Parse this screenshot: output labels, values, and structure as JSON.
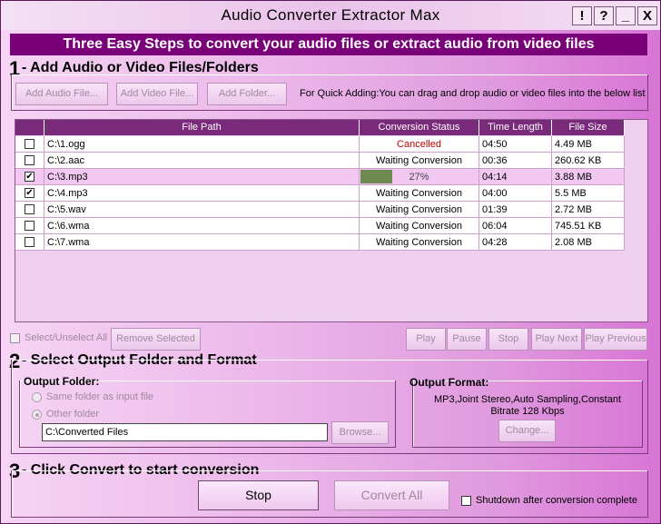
{
  "window": {
    "title": "Audio Converter Extractor Max",
    "btn_excl": "!",
    "btn_help": "?",
    "btn_min": "_",
    "btn_close": "X"
  },
  "banner": "Three Easy Steps to convert your audio files or extract audio from video files",
  "step1": {
    "num": "1",
    "title": "- Add Audio or Video Files/Folders",
    "add_audio": "Add Audio File...",
    "add_video": "Add Video File...",
    "add_folder": "Add Folder...",
    "hint": "For Quick Adding:You can drag and drop audio or video files into the below list"
  },
  "table": {
    "headers": [
      "File Path",
      "Conversion Status",
      "Time Length",
      "File Size"
    ],
    "rows": [
      {
        "checked": false,
        "path": "C:\\1.ogg",
        "status": "Cancelled",
        "time": "04:50",
        "size": "4.49 MB",
        "progress": null
      },
      {
        "checked": false,
        "path": "C:\\2.aac",
        "status": "Waiting Conversion",
        "time": "00:36",
        "size": "260.62 KB",
        "progress": null
      },
      {
        "checked": true,
        "path": "C:\\3.mp3",
        "status": "27%",
        "time": "04:14",
        "size": "3.88 MB",
        "progress": 0.27
      },
      {
        "checked": true,
        "path": "C:\\4.mp3",
        "status": "Waiting Conversion",
        "time": "04:00",
        "size": "5.5 MB",
        "progress": null
      },
      {
        "checked": false,
        "path": "C:\\5.wav",
        "status": "Waiting Conversion",
        "time": "01:39",
        "size": "2.72 MB",
        "progress": null
      },
      {
        "checked": false,
        "path": "C:\\6.wma",
        "status": "Waiting Conversion",
        "time": "06:04",
        "size": "745.51 KB",
        "progress": null
      },
      {
        "checked": false,
        "path": "C:\\7.wma",
        "status": "Waiting Conversion",
        "time": "04:28",
        "size": "2.08 MB",
        "progress": null
      }
    ],
    "colors": {
      "cancelled": "#c00000",
      "progress_fill": "#6e8a50"
    }
  },
  "list_controls": {
    "select_all": "Select/Unselect All",
    "remove": "Remove Selected",
    "play": "Play",
    "pause": "Pause",
    "stop": "Stop",
    "play_next": "Play Next",
    "play_previous": "Play Previous"
  },
  "step2": {
    "num": "2",
    "title": "- Select Output Folder and Format",
    "output_folder_label": "Output Folder:",
    "same_folder": "Same folder as input file",
    "other_folder": "Other folder",
    "folder_path": "C:\\Converted Files",
    "browse": "Browse...",
    "output_format_label": "Output Format:",
    "format_line1": "MP3,Joint Stereo,Auto Sampling,Constant",
    "format_line2": "Bitrate 128 Kbps",
    "change": "Change..."
  },
  "step3": {
    "num": "3",
    "title": "- Click Convert to start conversion",
    "stop": "Stop",
    "convert_all": "Convert All",
    "shutdown": "Shutdown after conversion complete"
  }
}
